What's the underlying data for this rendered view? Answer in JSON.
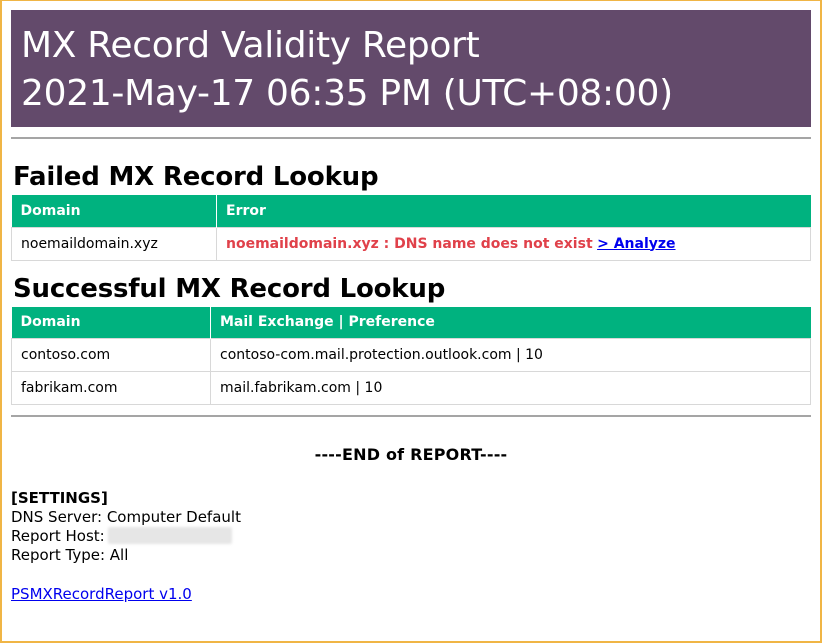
{
  "header": {
    "title": "MX Record Validity Report",
    "datetime": "2021-May-17 06:35 PM (UTC+08:00)"
  },
  "failed": {
    "heading": "Failed MX Record Lookup",
    "columns": [
      "Domain",
      "Error"
    ],
    "rows": [
      {
        "domain": "noemaildomain.xyz",
        "error": "noemaildomain.xyz : DNS name does not exist",
        "analyze_label": "> Analyze"
      }
    ]
  },
  "success": {
    "heading": "Successful MX Record Lookup",
    "columns": [
      "Domain",
      "Mail Exchange | Preference"
    ],
    "rows": [
      {
        "domain": "contoso.com",
        "mx": "contoso-com.mail.protection.outlook.com | 10"
      },
      {
        "domain": "fabrikam.com",
        "mx": "mail.fabrikam.com | 10"
      }
    ]
  },
  "end_text": "----END of REPORT----",
  "settings": {
    "title": "[SETTINGS]",
    "dns_server_label": "DNS Server: ",
    "dns_server_value": "Computer Default",
    "report_host_label": "Report Host:",
    "report_type_label": "Report Type: ",
    "report_type_value": "All"
  },
  "version_link": "PSMXRecordReport v1.0",
  "colors": {
    "header_bg": "#634a6b",
    "table_header_bg": "#00b27f",
    "error_text": "#e0414a",
    "link": "#0000ee",
    "window_border": "#f0b545"
  }
}
